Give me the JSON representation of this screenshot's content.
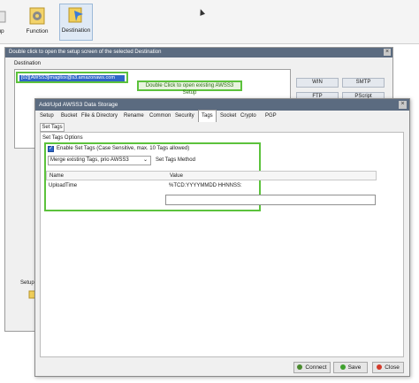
{
  "toolbar": {
    "partial_left_label": "up",
    "function_label": "Function",
    "destination_label": "Destination"
  },
  "dest_window": {
    "title": "Double click to open the setup screen of the selected Destination",
    "list_label": "Destination",
    "selected_item": "[02][AWSS3]imagitox@s3.amazonaws.com",
    "note": "Double Click to open existing AWSS3 Setup",
    "side_buttons": [
      "WIN",
      "SMTP",
      "FTP",
      "PScript"
    ],
    "setup_label": "Setup"
  },
  "dialog": {
    "title": "Add/Upd AWSS3 Data Storage",
    "tabs": [
      "Setup",
      "Bucket",
      "File & Directory",
      "Rename",
      "Common",
      "Security",
      "Tags",
      "Socket",
      "Crypto",
      "PGP"
    ],
    "active_tab": "Tags",
    "subtab": "Set Tags",
    "group_label": "Set Tags Options",
    "checkbox_label": "Enable Set Tags (Case Sensitive, max. 10 Tags allowed)",
    "checkbox_checked": true,
    "merge_select_value": "Merge existing Tags, prio AWSS3",
    "merge_select_label": "Set Tags Method",
    "grid": {
      "columns": [
        "Name",
        "Value"
      ],
      "rows": [
        {
          "name": "UploadTime",
          "value": "%TCD:YYYYMMDD HHNNSS:"
        }
      ]
    },
    "buttons": {
      "connect": "Connect",
      "save": "Save",
      "close": "Close"
    }
  },
  "colors": {
    "highlight_green": "#5cc23c",
    "selection_blue": "#2f66c8",
    "title_bar": "#5b6b80"
  }
}
